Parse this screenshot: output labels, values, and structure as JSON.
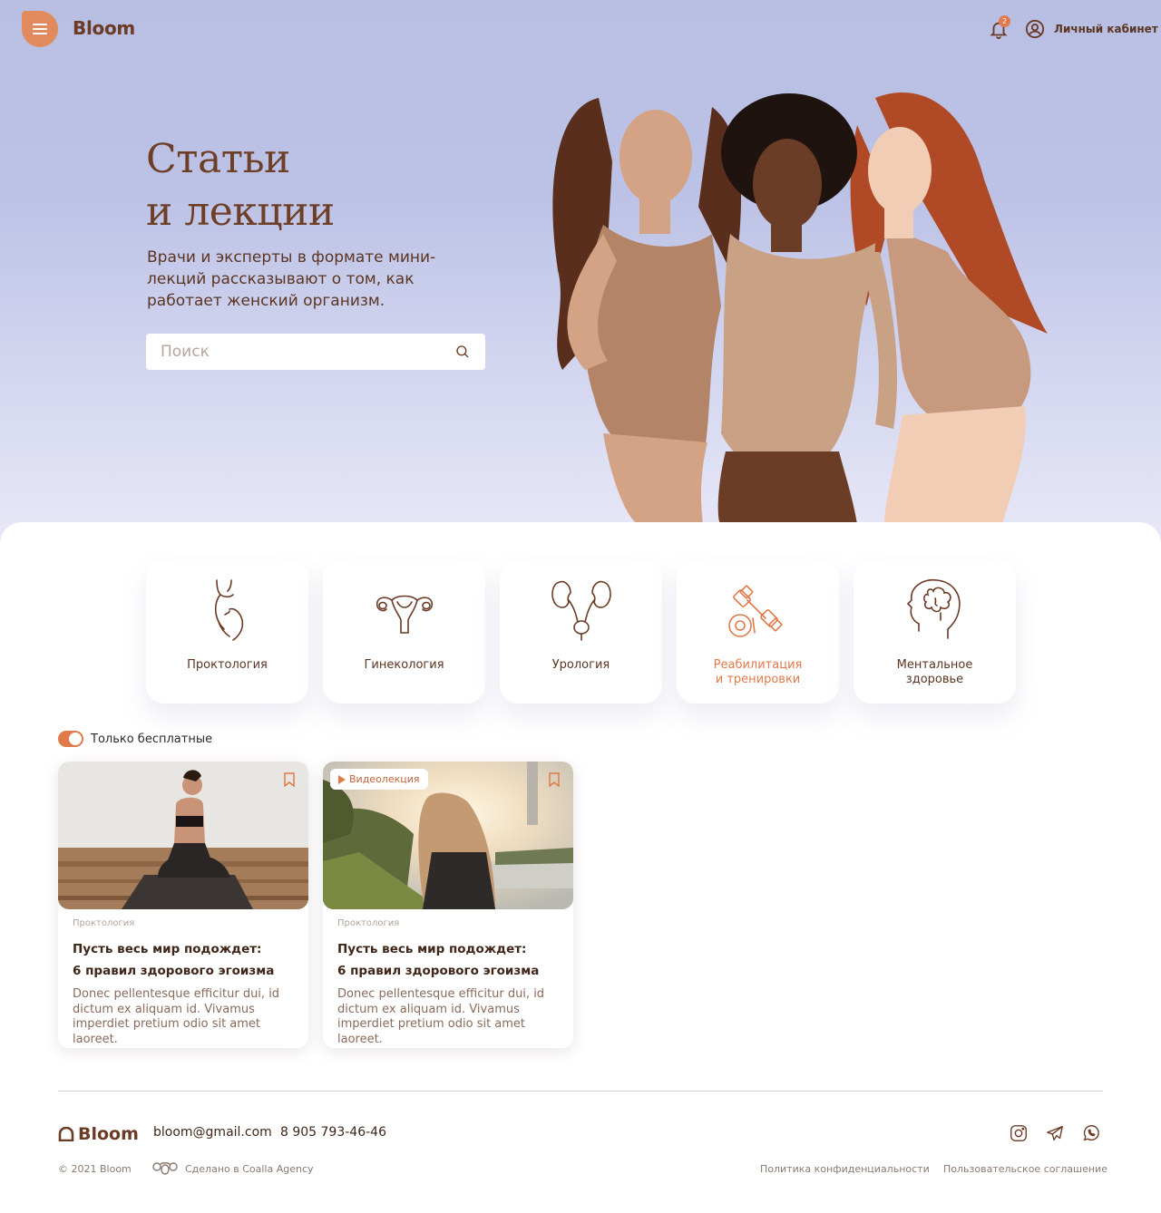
{
  "header": {
    "logo": "Bloom",
    "notifications_count": "2",
    "account_label": "Личный кабинет"
  },
  "hero": {
    "title_line1": "Статьи",
    "title_line2": "и лекции",
    "subtitle": "Врачи и эксперты в формате мини-лекций рассказывают о том, как работает женский организм.",
    "search_placeholder": "Поиск"
  },
  "categories": [
    {
      "label": "Проктология",
      "icon": "body-silhouette-icon",
      "active": false
    },
    {
      "label": "Гинекология",
      "icon": "uterus-icon",
      "active": false
    },
    {
      "label": "Урология",
      "icon": "kidneys-icon",
      "active": false
    },
    {
      "label": "Реабилитация\nи тренировки",
      "icon": "dumbbell-icon",
      "active": true
    },
    {
      "label": "Ментальное\nздоровье",
      "icon": "brain-head-icon",
      "active": false
    }
  ],
  "filters": {
    "free_only_label": "Только бесплатные",
    "free_only_on": true
  },
  "articles": [
    {
      "category": "Проктология",
      "title": "Пусть весь мир подождет:\n6 правил здорового эгоизма",
      "description": "Donec pellentesque efficitur dui, id dictum ex aliquam id. Vivamus imperdiet pretium odio sit amet laoreet.",
      "badge": ""
    },
    {
      "category": "Проктология",
      "title": "Пусть весь мир подождет:\n6 правил здорового эгоизма",
      "description": "Donec pellentesque efficitur dui, id dictum ex aliquam id. Vivamus imperdiet pretium odio sit amet laoreet.",
      "badge": "Видеолекция"
    }
  ],
  "footer": {
    "logo": "Bloom",
    "email": "bloom@gmail.com",
    "phone": "8 905 793-46-46",
    "copyright": "© 2021 Bloom",
    "made_by": "Сделано в Coalla Agency",
    "privacy_policy": "Политика конфиденциальности",
    "user_agreement": "Пользовательское соглашение",
    "socials": [
      "instagram-icon",
      "telegram-icon",
      "whatsapp-icon"
    ]
  },
  "colors": {
    "accent": "#e07a4a",
    "brand_brown": "#6b3b25",
    "hero_bg": "#b8bfe3"
  }
}
